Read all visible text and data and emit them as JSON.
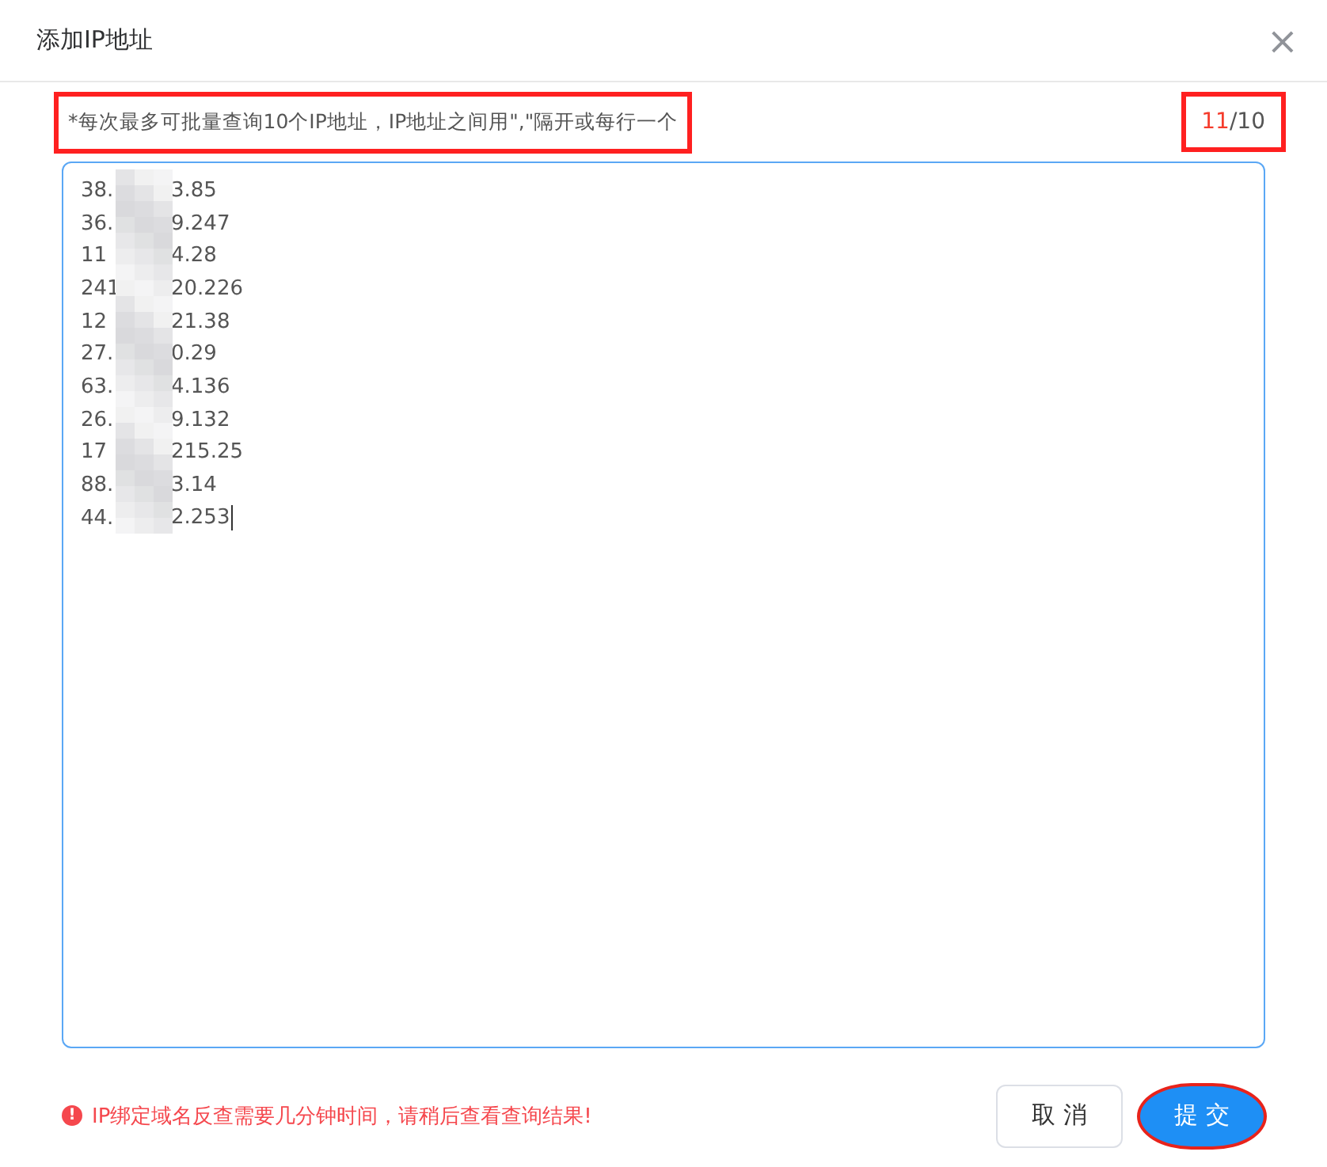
{
  "dialog": {
    "title": "添加IP地址",
    "close": "×"
  },
  "hint": {
    "text": "*每次最多可批量查询10个IP地址，IP地址之间用\",\"隔开或每行一个",
    "boxed": true
  },
  "counter": {
    "count": "11",
    "separator": "/",
    "limit": "10",
    "over": true,
    "boxed": true
  },
  "textarea": {
    "focused": true,
    "lines": [
      {
        "start": "38.",
        "end": "3.85"
      },
      {
        "start": "36.",
        "end": "9.247"
      },
      {
        "start": "11",
        "end": "4.28"
      },
      {
        "start": "241",
        "end": "20.226"
      },
      {
        "start": "12",
        "end": "21.38"
      },
      {
        "start": "27.",
        "end": "0.29"
      },
      {
        "start": "63.",
        "end": "4.136"
      },
      {
        "start": "26.",
        "end": "9.132"
      },
      {
        "start": "17",
        "end": "215.25"
      },
      {
        "start": "88.",
        "end": "3.14"
      },
      {
        "start": "44.",
        "end": "2.253"
      }
    ]
  },
  "warning": {
    "icon": "!",
    "text": "IP绑定域名反查需要几分钟时间，请稍后查看查询结果!"
  },
  "buttons": [
    {
      "label": "取 消",
      "kind": "default",
      "circled": false
    },
    {
      "label": "提 交",
      "kind": "primary",
      "circled": true
    }
  ]
}
